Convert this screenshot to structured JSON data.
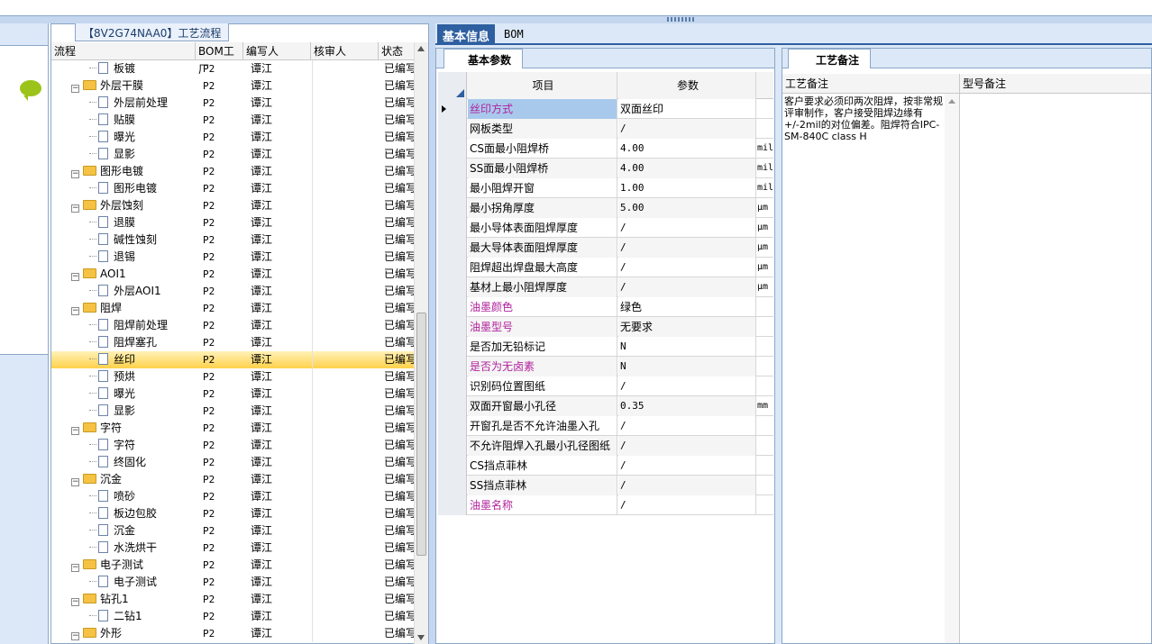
{
  "tree_panel": {
    "tab_label": "【8V2G74NAA0】工艺流程",
    "columns": [
      "流程",
      "BOM工厂",
      "编写人",
      "核审人",
      "状态"
    ],
    "rows": [
      {
        "label": "板镀",
        "type": "file",
        "level": 2,
        "bom": "P2",
        "writer": "谭江",
        "status": "已编写"
      },
      {
        "label": "外层干膜",
        "type": "folder",
        "level": 1,
        "bom": "P2",
        "writer": "谭江",
        "status": "已编写"
      },
      {
        "label": "外层前处理",
        "type": "file",
        "level": 2,
        "bom": "P2",
        "writer": "谭江",
        "status": "已编写"
      },
      {
        "label": "贴膜",
        "type": "file",
        "level": 2,
        "bom": "P2",
        "writer": "谭江",
        "status": "已编写"
      },
      {
        "label": "曝光",
        "type": "file",
        "level": 2,
        "bom": "P2",
        "writer": "谭江",
        "status": "已编写"
      },
      {
        "label": "显影",
        "type": "file",
        "level": 2,
        "bom": "P2",
        "writer": "谭江",
        "status": "已编写"
      },
      {
        "label": "图形电镀",
        "type": "folder",
        "level": 1,
        "bom": "P2",
        "writer": "谭江",
        "status": "已编写"
      },
      {
        "label": "图形电镀",
        "type": "file",
        "level": 2,
        "bom": "P2",
        "writer": "谭江",
        "status": "已编写"
      },
      {
        "label": "外层蚀刻",
        "type": "folder",
        "level": 1,
        "bom": "P2",
        "writer": "谭江",
        "status": "已编写"
      },
      {
        "label": "退膜",
        "type": "file",
        "level": 2,
        "bom": "P2",
        "writer": "谭江",
        "status": "已编写"
      },
      {
        "label": "碱性蚀刻",
        "type": "file",
        "level": 2,
        "bom": "P2",
        "writer": "谭江",
        "status": "已编写"
      },
      {
        "label": "退锡",
        "type": "file",
        "level": 2,
        "bom": "P2",
        "writer": "谭江",
        "status": "已编写"
      },
      {
        "label": "AOI1",
        "type": "folder",
        "level": 1,
        "bom": "P2",
        "writer": "谭江",
        "status": "已编写"
      },
      {
        "label": "外层AOI1",
        "type": "file",
        "level": 2,
        "bom": "P2",
        "writer": "谭江",
        "status": "已编写"
      },
      {
        "label": "阻焊",
        "type": "folder",
        "level": 1,
        "bom": "P2",
        "writer": "谭江",
        "status": "已编写"
      },
      {
        "label": "阻焊前处理",
        "type": "file",
        "level": 2,
        "bom": "P2",
        "writer": "谭江",
        "status": "已编写"
      },
      {
        "label": "阻焊塞孔",
        "type": "file",
        "level": 2,
        "bom": "P2",
        "writer": "谭江",
        "status": "已编写"
      },
      {
        "label": "丝印",
        "type": "file",
        "level": 2,
        "bom": "P2",
        "writer": "谭江",
        "status": "已编写",
        "selected": true
      },
      {
        "label": "预烘",
        "type": "file",
        "level": 2,
        "bom": "P2",
        "writer": "谭江",
        "status": "已编写"
      },
      {
        "label": "曝光",
        "type": "file",
        "level": 2,
        "bom": "P2",
        "writer": "谭江",
        "status": "已编写"
      },
      {
        "label": "显影",
        "type": "file",
        "level": 2,
        "bom": "P2",
        "writer": "谭江",
        "status": "已编写"
      },
      {
        "label": "字符",
        "type": "folder",
        "level": 1,
        "bom": "P2",
        "writer": "谭江",
        "status": "已编写"
      },
      {
        "label": "字符",
        "type": "file",
        "level": 2,
        "bom": "P2",
        "writer": "谭江",
        "status": "已编写"
      },
      {
        "label": "终固化",
        "type": "file",
        "level": 2,
        "bom": "P2",
        "writer": "谭江",
        "status": "已编写"
      },
      {
        "label": "沉金",
        "type": "folder",
        "level": 1,
        "bom": "P2",
        "writer": "谭江",
        "status": "已编写"
      },
      {
        "label": "喷砂",
        "type": "file",
        "level": 2,
        "bom": "P2",
        "writer": "谭江",
        "status": "已编写"
      },
      {
        "label": "板边包胶",
        "type": "file",
        "level": 2,
        "bom": "P2",
        "writer": "谭江",
        "status": "已编写"
      },
      {
        "label": "沉金",
        "type": "file",
        "level": 2,
        "bom": "P2",
        "writer": "谭江",
        "status": "已编写"
      },
      {
        "label": "水洗烘干",
        "type": "file",
        "level": 2,
        "bom": "P2",
        "writer": "谭江",
        "status": "已编写"
      },
      {
        "label": "电子测试",
        "type": "folder",
        "level": 1,
        "bom": "P2",
        "writer": "谭江",
        "status": "已编写"
      },
      {
        "label": "电子测试",
        "type": "file",
        "level": 2,
        "bom": "P2",
        "writer": "谭江",
        "status": "已编写"
      },
      {
        "label": "钻孔1",
        "type": "folder",
        "level": 1,
        "bom": "P2",
        "writer": "谭江",
        "status": "已编写"
      },
      {
        "label": "二钻1",
        "type": "file",
        "level": 2,
        "bom": "P2",
        "writer": "谭江",
        "status": "已编写"
      },
      {
        "label": "外形",
        "type": "folder",
        "level": 1,
        "bom": "P2",
        "writer": "谭江",
        "status": "已编写"
      }
    ]
  },
  "main_tabs": {
    "active": "基本信息",
    "inactive": "BOM"
  },
  "param_panel": {
    "subtab": "基本参数",
    "col_item": "项目",
    "col_param": "参数",
    "rows": [
      {
        "name": "丝印方式",
        "value": "双面丝印",
        "unit": "",
        "highlight": true,
        "current": true
      },
      {
        "name": "网板类型",
        "value": "/",
        "unit": "",
        "highlight": false
      },
      {
        "name": "CS面最小阻焊桥",
        "value": "4.00",
        "unit": "mil",
        "highlight": false
      },
      {
        "name": "SS面最小阻焊桥",
        "value": "4.00",
        "unit": "mil",
        "highlight": false
      },
      {
        "name": "最小阻焊开窗",
        "value": "1.00",
        "unit": "mil",
        "highlight": false
      },
      {
        "name": "最小拐角厚度",
        "value": "5.00",
        "unit": "μm",
        "highlight": false
      },
      {
        "name": "最小导体表面阻焊厚度",
        "value": "/",
        "unit": "μm",
        "highlight": false
      },
      {
        "name": "最大导体表面阻焊厚度",
        "value": "/",
        "unit": "μm",
        "highlight": false
      },
      {
        "name": "阻焊超出焊盘最大高度",
        "value": "/",
        "unit": "μm",
        "highlight": false
      },
      {
        "name": "基材上最小阻焊厚度",
        "value": "/",
        "unit": "μm",
        "highlight": false
      },
      {
        "name": "油墨颜色",
        "value": "绿色",
        "unit": "",
        "highlight": true
      },
      {
        "name": "油墨型号",
        "value": "无要求",
        "unit": "",
        "highlight": true
      },
      {
        "name": "是否加无铅标记",
        "value": "N",
        "unit": "",
        "highlight": false
      },
      {
        "name": "是否为无卤素",
        "value": "N",
        "unit": "",
        "highlight": true
      },
      {
        "name": "识别码位置图纸",
        "value": "/",
        "unit": "",
        "highlight": false
      },
      {
        "name": "双面开窗最小孔径",
        "value": "0.35",
        "unit": "mm",
        "highlight": false
      },
      {
        "name": "开窗孔是否不允许油墨入孔",
        "value": "/",
        "unit": "",
        "highlight": false
      },
      {
        "name": "不允许阻焊入孔最小孔径图纸",
        "value": "/",
        "unit": "",
        "highlight": false
      },
      {
        "name": "CS挡点菲林",
        "value": "/",
        "unit": "",
        "highlight": false
      },
      {
        "name": "SS挡点菲林",
        "value": "/",
        "unit": "",
        "highlight": false
      },
      {
        "name": "油墨名称",
        "value": "/",
        "unit": "",
        "highlight": true
      }
    ]
  },
  "note_panel": {
    "tab": "工艺备注",
    "col_process_note": "工艺备注",
    "col_model_note": "型号备注",
    "process_note_text": "客户要求必须印两次阻焊，按非常规评审制作，客户接受阻焊边缘有+/-2mil的对位偏差。阻焊符合IPC-SM-840C class H"
  },
  "colors": {
    "accent": "#2e5fa0",
    "highlight_text": "#b0229c",
    "selected_row": "#ffd24a"
  }
}
